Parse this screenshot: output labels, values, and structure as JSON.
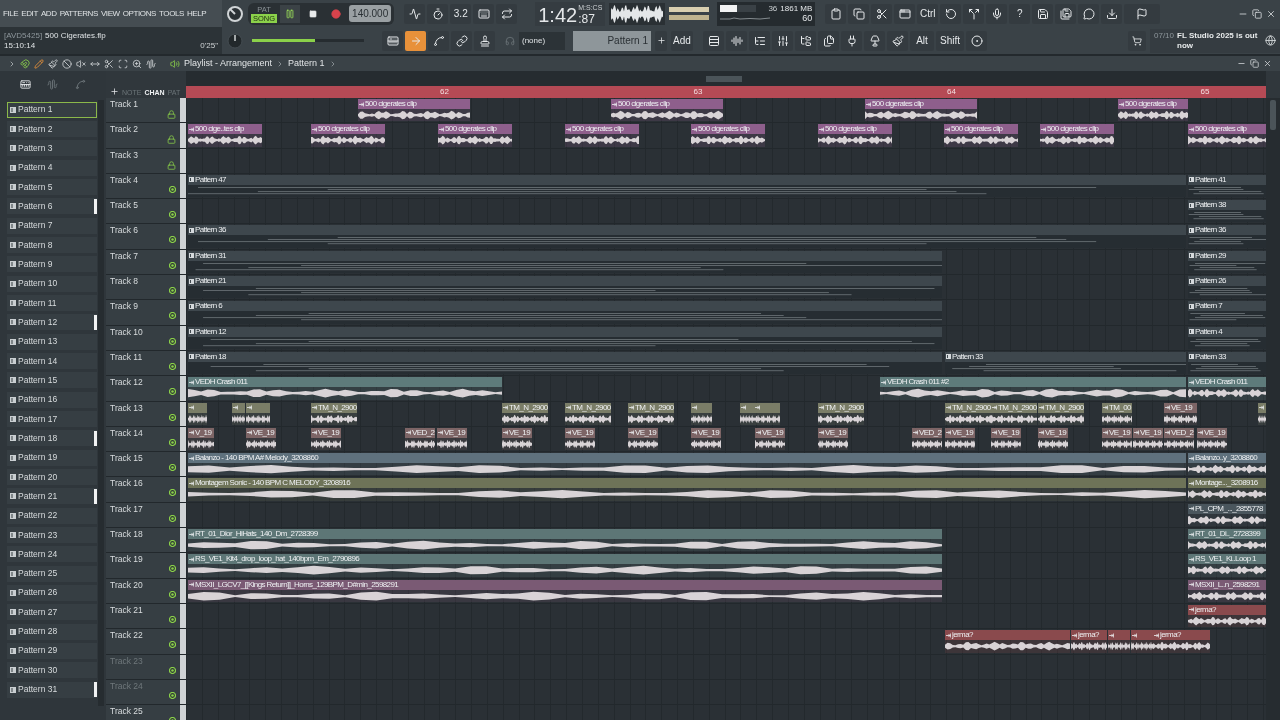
{
  "menu": [
    "FILE",
    "EDIT",
    "ADD",
    "PATTERNS",
    "VIEW",
    "OPTIONS",
    "TOOLS",
    "HELP"
  ],
  "transport": {
    "pat": "PAT",
    "song": "SONG",
    "song_mode": true,
    "playing": true,
    "tempo": "140.000"
  },
  "toolbar": {
    "countdown": "3.2",
    "ctrl": "Ctrl",
    "help": "?",
    "alt": "Alt",
    "shift": "Shift"
  },
  "time": {
    "main": "1:42",
    "sub": ":87",
    "label": "M:S:CS"
  },
  "cpu": {
    "value": "36",
    "memory": "1861 MB",
    "polyphony": "60",
    "level": 0.45
  },
  "project": {
    "tag": "[AVD5425]",
    "file": "500 Cigerates.flp",
    "clock": "15:10:14",
    "duration": "0'25\""
  },
  "master_volume": {
    "level": 0.56
  },
  "edit_tools": [
    {
      "selected": false
    },
    {
      "selected": true
    },
    {
      "selected": false
    },
    {
      "selected": false
    },
    {
      "selected": false
    }
  ],
  "pattern_selector": {
    "snap": "(none)",
    "pattern": "Pattern 1",
    "add": "Add"
  },
  "news": {
    "date": "07/10",
    "text": "FL Studio 2025 is out now"
  },
  "playlist": {
    "title": "Playlist - Arrangement",
    "pattern": "Pattern 1"
  },
  "picker_modes": [
    {
      "label": "NOTE",
      "selected": false
    },
    {
      "label": "CHAN",
      "selected": true
    },
    {
      "label": "PAT",
      "selected": false
    }
  ],
  "ruler": [
    "62",
    "63",
    "64",
    "65"
  ],
  "patterns": [
    {
      "name": "Pattern 1",
      "selected": true,
      "marked": false
    },
    {
      "name": "Pattern 2",
      "selected": false,
      "marked": false
    },
    {
      "name": "Pattern 3",
      "selected": false,
      "marked": false
    },
    {
      "name": "Pattern 4",
      "selected": false,
      "marked": false
    },
    {
      "name": "Pattern 5",
      "selected": false,
      "marked": false
    },
    {
      "name": "Pattern 6",
      "selected": false,
      "marked": true
    },
    {
      "name": "Pattern 7",
      "selected": false,
      "marked": false
    },
    {
      "name": "Pattern 8",
      "selected": false,
      "marked": false
    },
    {
      "name": "Pattern 9",
      "selected": false,
      "marked": false
    },
    {
      "name": "Pattern 10",
      "selected": false,
      "marked": false
    },
    {
      "name": "Pattern 11",
      "selected": false,
      "marked": false
    },
    {
      "name": "Pattern 12",
      "selected": false,
      "marked": true
    },
    {
      "name": "Pattern 13",
      "selected": false,
      "marked": false
    },
    {
      "name": "Pattern 14",
      "selected": false,
      "marked": false
    },
    {
      "name": "Pattern 15",
      "selected": false,
      "marked": false
    },
    {
      "name": "Pattern 16",
      "selected": false,
      "marked": false
    },
    {
      "name": "Pattern 17",
      "selected": false,
      "marked": false
    },
    {
      "name": "Pattern 18",
      "selected": false,
      "marked": true
    },
    {
      "name": "Pattern 19",
      "selected": false,
      "marked": false
    },
    {
      "name": "Pattern 20",
      "selected": false,
      "marked": false
    },
    {
      "name": "Pattern 21",
      "selected": false,
      "marked": true
    },
    {
      "name": "Pattern 22",
      "selected": false,
      "marked": false
    },
    {
      "name": "Pattern 23",
      "selected": false,
      "marked": false
    },
    {
      "name": "Pattern 24",
      "selected": false,
      "marked": false
    },
    {
      "name": "Pattern 25",
      "selected": false,
      "marked": false
    },
    {
      "name": "Pattern 26",
      "selected": false,
      "marked": false
    },
    {
      "name": "Pattern 27",
      "selected": false,
      "marked": false
    },
    {
      "name": "Pattern 28",
      "selected": false,
      "marked": false
    },
    {
      "name": "Pattern 29",
      "selected": false,
      "marked": false
    },
    {
      "name": "Pattern 30",
      "selected": false,
      "marked": false
    },
    {
      "name": "Pattern 31",
      "selected": false,
      "marked": true
    }
  ],
  "tracks": [
    {
      "name": "Track 1",
      "locked": true,
      "disabled": false,
      "clips": [
        {
          "label": "500 cigerates clip",
          "kind": "audio",
          "color": "#8e5f8c"
        },
        {
          "label": "500 cigerates clip",
          "kind": "audio",
          "color": "#8e5f8c"
        },
        {
          "label": "500 cigerates clip",
          "kind": "audio",
          "color": "#8e5f8c"
        },
        {
          "label": "500 cigerates clip",
          "kind": "audio",
          "color": "#8e5f8c"
        }
      ]
    },
    {
      "name": "Track 2",
      "locked": true,
      "disabled": false,
      "clips": [
        {
          "label": "500 cige..tes clip",
          "kind": "audio",
          "color": "#8e5f8c"
        },
        {
          "label": "500 cigerates clip",
          "kind": "audio",
          "color": "#8e5f8c"
        },
        {
          "label": "500 cigerates clip",
          "kind": "audio",
          "color": "#8e5f8c"
        },
        {
          "label": "500 cigerates clip",
          "kind": "audio",
          "color": "#8e5f8c"
        },
        {
          "label": "500 cigerates clip",
          "kind": "audio",
          "color": "#8e5f8c"
        },
        {
          "label": "500 cigerates clip",
          "kind": "audio",
          "color": "#8e5f8c"
        },
        {
          "label": "500 cigerates clip",
          "kind": "audio",
          "color": "#8e5f8c"
        },
        {
          "label": "500 cigerates clip",
          "kind": "audio",
          "color": "#8e5f8c"
        },
        {
          "label": "500 cigerates clip",
          "kind": "audio",
          "color": "#8e5f8c"
        }
      ]
    },
    {
      "name": "Track 3",
      "locked": true,
      "disabled": false
    },
    {
      "name": "Track 4",
      "locked": false,
      "disabled": false,
      "clips": [
        {
          "label": "Pattern 47",
          "kind": "pattern",
          "color": "#3e474d"
        },
        {
          "label": "Pattern 41",
          "kind": "pattern",
          "color": "#3e474d"
        }
      ]
    },
    {
      "name": "Track 5",
      "locked": false,
      "disabled": false,
      "clips": [
        {
          "label": "Pattern 38",
          "kind": "pattern",
          "color": "#3e474d"
        }
      ]
    },
    {
      "name": "Track 6",
      "locked": false,
      "disabled": false,
      "clips": [
        {
          "label": "Pattern 36",
          "kind": "pattern",
          "color": "#3e474d"
        },
        {
          "label": "Pattern 36",
          "kind": "pattern",
          "color": "#3e474d"
        }
      ]
    },
    {
      "name": "Track 7",
      "locked": false,
      "disabled": false,
      "clips": [
        {
          "label": "Pattern 31",
          "kind": "pattern",
          "color": "#3e474d"
        },
        {
          "label": "Pattern 29",
          "kind": "pattern",
          "color": "#3e474d"
        }
      ]
    },
    {
      "name": "Track 8",
      "locked": false,
      "disabled": false,
      "clips": [
        {
          "label": "Pattern 21",
          "kind": "pattern",
          "color": "#3e474d"
        },
        {
          "label": "Pattern 26",
          "kind": "pattern",
          "color": "#3e474d"
        }
      ]
    },
    {
      "name": "Track 9",
      "locked": false,
      "disabled": false,
      "clips": [
        {
          "label": "Pattern 6",
          "kind": "pattern",
          "color": "#3e474d"
        },
        {
          "label": "Pattern 7",
          "kind": "pattern",
          "color": "#3e474d"
        }
      ]
    },
    {
      "name": "Track 10",
      "locked": false,
      "disabled": false,
      "clips": [
        {
          "label": "Pattern 12",
          "kind": "pattern",
          "color": "#3e474d"
        },
        {
          "label": "Pattern 4",
          "kind": "pattern",
          "color": "#3e474d"
        }
      ]
    },
    {
      "name": "Track 11",
      "locked": false,
      "disabled": false,
      "clips": [
        {
          "label": "Pattern 18",
          "kind": "pattern",
          "color": "#3e474d"
        },
        {
          "label": "Pattern 33",
          "kind": "pattern",
          "color": "#3e474d"
        },
        {
          "label": "Pattern 33",
          "kind": "pattern",
          "color": "#3e474d"
        }
      ]
    },
    {
      "name": "Track 12",
      "locked": false,
      "disabled": false,
      "clips": [
        {
          "label": "VEDH Crash 011",
          "kind": "audio",
          "color": "#5e7b7b"
        },
        {
          "label": "VEDH Crash 011 #2",
          "kind": "audio",
          "color": "#5e7b7b"
        },
        {
          "label": "VEDH Crash 011",
          "kind": "audio",
          "color": "#5e7b7b"
        }
      ]
    },
    {
      "name": "Track 13",
      "locked": false,
      "disabled": false,
      "clips": [
        {
          "kind": "audio",
          "color": "#7a7d67"
        },
        {
          "kind": "audio",
          "color": "#7a7d67"
        },
        {
          "kind": "audio",
          "color": "#7a7d67"
        },
        {
          "label": "TM_N_2900",
          "kind": "audio",
          "color": "#7a7d67"
        },
        {
          "label": "TM_N_2900",
          "kind": "audio",
          "color": "#7a7d67"
        },
        {
          "label": "TM_N_2900",
          "kind": "audio",
          "color": "#7a7d67"
        },
        {
          "label": "TM_N_2900",
          "kind": "audio",
          "color": "#7a7d67"
        },
        {
          "kind": "audio",
          "color": "#7a7d67"
        },
        {
          "kind": "audio",
          "color": "#7a7d67"
        },
        {
          "kind": "audio",
          "color": "#7a7d67"
        },
        {
          "label": "TM_N_2900",
          "kind": "audio",
          "color": "#7a7d67"
        },
        {
          "label": "TM_N_2900",
          "kind": "audio",
          "color": "#7a7d67"
        },
        {
          "label": "TM_N_2900",
          "kind": "audio",
          "color": "#7a7d67"
        },
        {
          "label": "TM_N_2900",
          "kind": "audio",
          "color": "#7a7d67"
        },
        {
          "label": "TM_00",
          "kind": "audio",
          "color": "#7a7d67"
        },
        {
          "label": "VE_19",
          "kind": "audio",
          "color": "#7d6566"
        },
        {
          "kind": "audio",
          "color": "#7a7d67"
        }
      ]
    },
    {
      "name": "Track 14",
      "locked": false,
      "disabled": false,
      "clips": [
        {
          "label": "V_19",
          "kind": "audio",
          "color": "#7d6566"
        },
        {
          "label": "VE_19",
          "kind": "audio",
          "color": "#7d6566"
        },
        {
          "label": "VE_19",
          "kind": "audio",
          "color": "#7d6566"
        },
        {
          "label": "VED_2",
          "kind": "audio",
          "color": "#7d6566"
        },
        {
          "label": "VE_19",
          "kind": "audio",
          "color": "#7d6566"
        },
        {
          "label": "VE_19",
          "kind": "audio",
          "color": "#7d6566"
        },
        {
          "label": "VE_19",
          "kind": "audio",
          "color": "#7d6566"
        },
        {
          "label": "VE_19",
          "kind": "audio",
          "color": "#7d6566"
        },
        {
          "label": "VE_19",
          "kind": "audio",
          "color": "#7d6566"
        },
        {
          "label": "VE_19",
          "kind": "audio",
          "color": "#7d6566"
        },
        {
          "label": "VE_19",
          "kind": "audio",
          "color": "#7d6566"
        },
        {
          "label": "VED_2",
          "kind": "audio",
          "color": "#7d6566"
        },
        {
          "label": "VE_19",
          "kind": "audio",
          "color": "#7d6566"
        },
        {
          "label": "VE_19",
          "kind": "audio",
          "color": "#7d6566"
        },
        {
          "label": "VE_19",
          "kind": "audio",
          "color": "#7d6566"
        },
        {
          "label": "VE_19",
          "kind": "audio",
          "color": "#7d6566"
        },
        {
          "label": "VE_19",
          "kind": "audio",
          "color": "#7d6566"
        },
        {
          "label": "VED_2",
          "kind": "audio",
          "color": "#7d6566"
        },
        {
          "label": "VE_19",
          "kind": "audio",
          "color": "#7d6566"
        }
      ]
    },
    {
      "name": "Track 15",
      "locked": false,
      "disabled": false,
      "clips": [
        {
          "label": "Balanzo - 140 BPM A# Melody_3208860",
          "kind": "audio",
          "color": "#5f717d"
        },
        {
          "label": "Balanzo..y_3208860",
          "kind": "audio",
          "color": "#5f717d"
        }
      ]
    },
    {
      "name": "Track 16",
      "locked": false,
      "disabled": false,
      "clips": [
        {
          "label": "Montagem Sonic  - 140 BPM C MELODY_3208916",
          "kind": "audio",
          "color": "#6e7358"
        },
        {
          "label": "Montage..._3208916",
          "kind": "audio",
          "color": "#6e7358"
        }
      ]
    },
    {
      "name": "Track 17",
      "locked": false,
      "disabled": false,
      "clips": [
        {
          "label": "PL_CPM_..._2855778",
          "kind": "audio",
          "color": "#4a565d"
        }
      ]
    },
    {
      "name": "Track 18",
      "locked": false,
      "disabled": false,
      "clips": [
        {
          "label": "RT_01_Dior_HiHats_140_Dm_2728399",
          "kind": "audio",
          "color": "#5d7676"
        },
        {
          "label": "RT_01_Di.._2728399",
          "kind": "audio",
          "color": "#5d7676"
        }
      ]
    },
    {
      "name": "Track 19",
      "locked": false,
      "disabled": false,
      "clips": [
        {
          "label": "RS_VE1_Kit4_drop_loop_hat_140bpm_Em_2790896",
          "kind": "audio",
          "color": "#5d7676"
        },
        {
          "label": "RS_VE1_Ki..Loop 1",
          "kind": "audio",
          "color": "#5d7676"
        }
      ]
    },
    {
      "name": "Track 20",
      "locked": false,
      "disabled": false,
      "clips": [
        {
          "label": "MSXII_LGCV7_[[Kings Return]]_Horns_129BPM_D#min_2598291",
          "kind": "audio",
          "color": "#7a5a74"
        },
        {
          "label": "MSXII_L..n_2598291",
          "kind": "audio",
          "color": "#7a5a74"
        }
      ]
    },
    {
      "name": "Track 21",
      "locked": false,
      "disabled": false,
      "clips": [
        {
          "label": "jerma?",
          "kind": "audio",
          "color": "#8a4a4d"
        }
      ]
    },
    {
      "name": "Track 22",
      "locked": false,
      "disabled": false,
      "clips": [
        {
          "label": "jerma?",
          "kind": "audio",
          "color": "#8a4a4d"
        },
        {
          "label": "jerma?",
          "kind": "audio",
          "color": "#8a4a4d"
        },
        {
          "kind": "audio",
          "color": "#8a4a4d"
        },
        {
          "kind": "audio",
          "color": "#8a4a4d"
        },
        {
          "label": "jerma?",
          "kind": "audio",
          "color": "#8a4a4d"
        }
      ]
    },
    {
      "name": "Track 23",
      "locked": false,
      "disabled": true
    },
    {
      "name": "Track 24",
      "locked": false,
      "disabled": true
    },
    {
      "name": "Track 25",
      "locked": false,
      "disabled": false
    }
  ]
}
